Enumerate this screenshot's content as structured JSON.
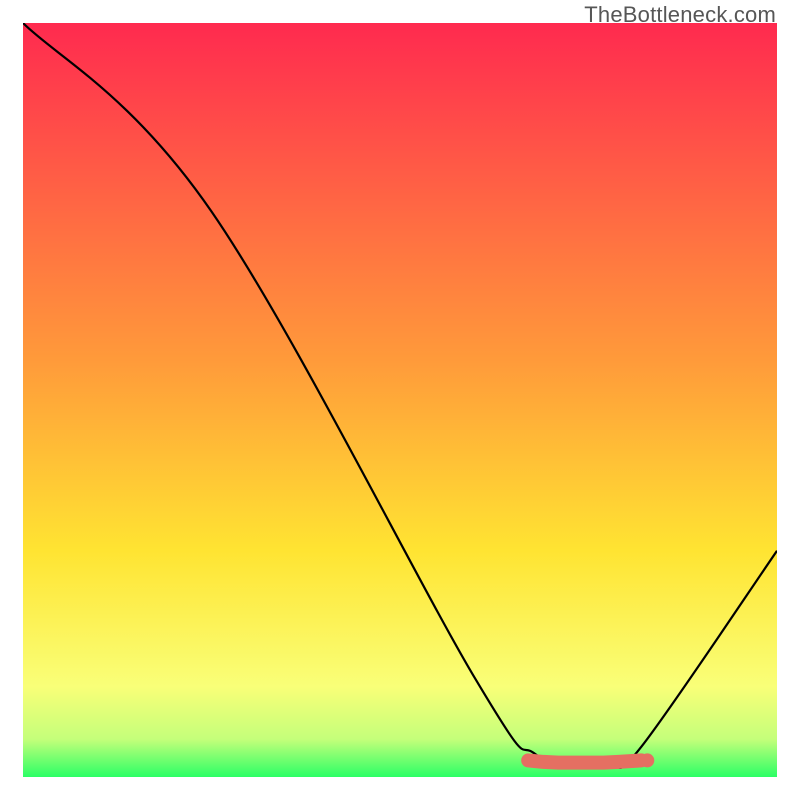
{
  "watermark": "TheBottleneck.com",
  "chart_data": {
    "type": "line",
    "title": "",
    "xlabel": "",
    "ylabel": "",
    "xlim": [
      0,
      100
    ],
    "ylim": [
      0,
      100
    ],
    "background_gradient": {
      "stops": [
        {
          "pct": 0,
          "color": "#ff2a4f"
        },
        {
          "pct": 45,
          "color": "#ff9b3a"
        },
        {
          "pct": 70,
          "color": "#ffe432"
        },
        {
          "pct": 88,
          "color": "#f9ff78"
        },
        {
          "pct": 95,
          "color": "#c4ff7a"
        },
        {
          "pct": 100,
          "color": "#2bff66"
        }
      ]
    },
    "series": [
      {
        "name": "bottleneck-curve",
        "color": "#000000",
        "x": [
          0,
          25,
          60,
          68,
          74,
          78,
          82,
          100
        ],
        "y": [
          100,
          75,
          13,
          3,
          2,
          2,
          4,
          30
        ]
      }
    ],
    "markers": {
      "name": "sweet-spot",
      "color": "#e56f62",
      "x": [
        67,
        69,
        71,
        73,
        75,
        77,
        79,
        82
      ],
      "y": [
        2.2,
        2.0,
        1.9,
        1.9,
        1.9,
        1.9,
        2.0,
        2.2
      ]
    }
  }
}
